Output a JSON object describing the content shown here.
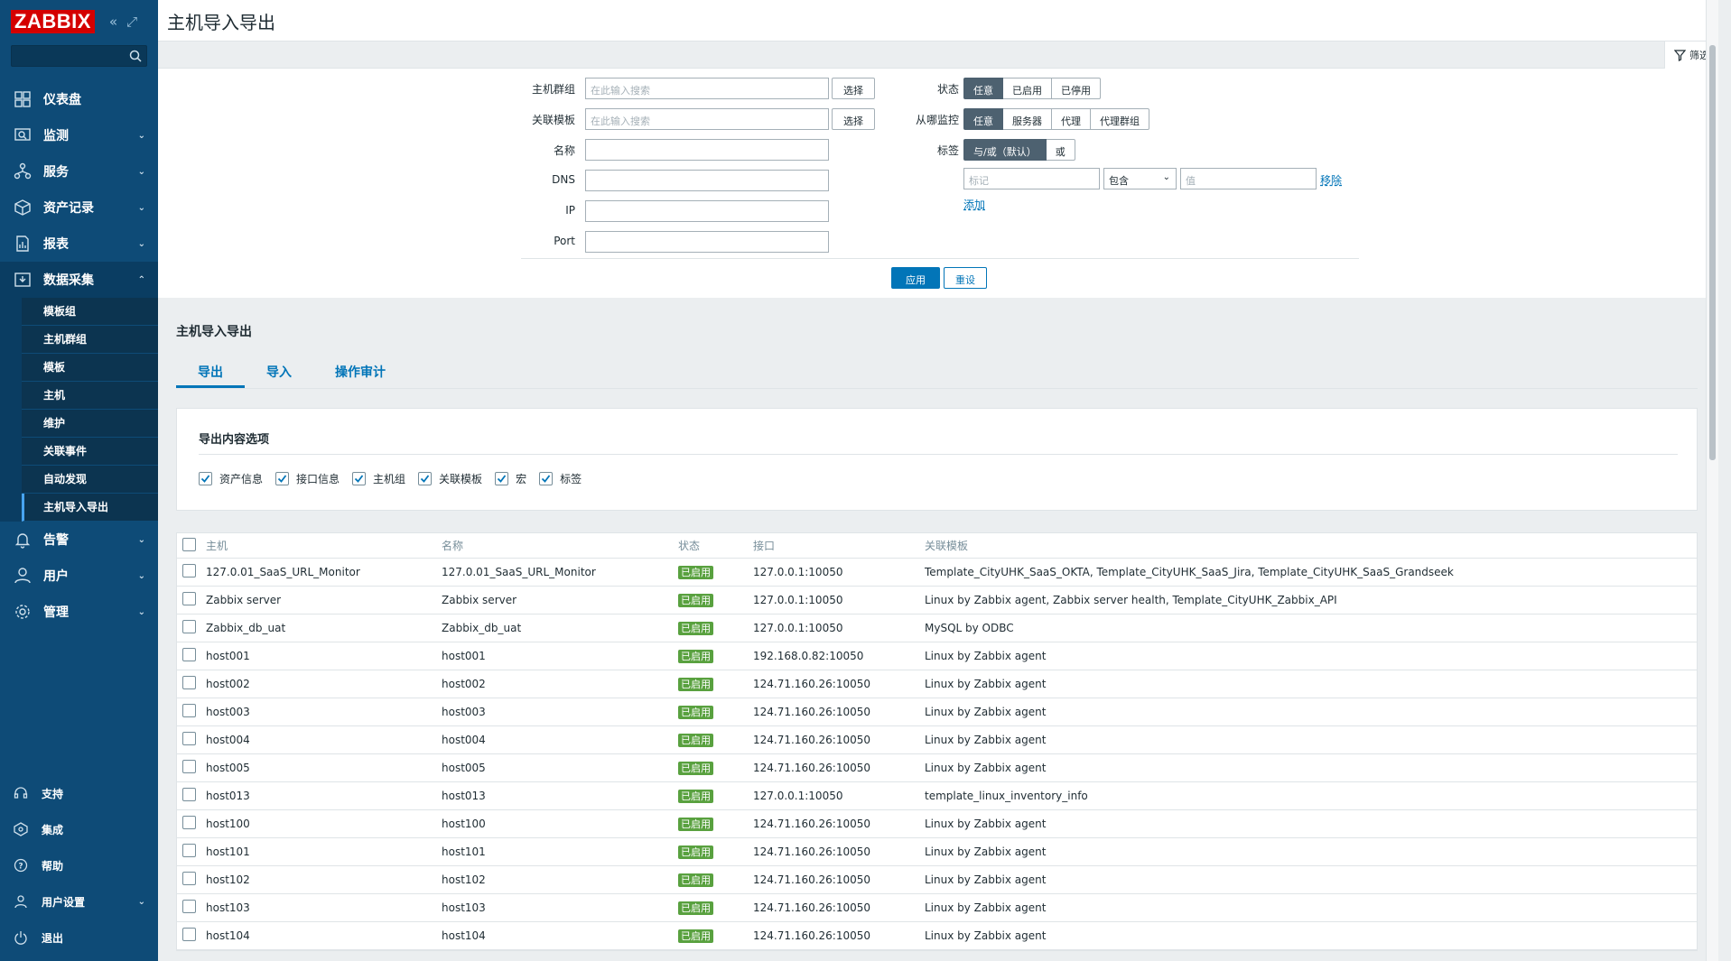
{
  "brand": "ZABBIX",
  "sidebar": {
    "items": [
      {
        "label": "仪表盘",
        "icon": "dashboard-icon"
      },
      {
        "label": "监测",
        "icon": "monitoring-icon"
      },
      {
        "label": "服务",
        "icon": "services-icon"
      },
      {
        "label": "资产记录",
        "icon": "inventory-icon"
      },
      {
        "label": "报表",
        "icon": "reports-icon"
      },
      {
        "label": "数据采集",
        "icon": "data-collection-icon"
      }
    ],
    "sub_items": [
      "模板组",
      "主机群组",
      "模板",
      "主机",
      "维护",
      "关联事件",
      "自动发现",
      "主机导入导出"
    ],
    "items_after": [
      {
        "label": "告警",
        "icon": "bell-icon"
      },
      {
        "label": "用户",
        "icon": "user-icon"
      },
      {
        "label": "管理",
        "icon": "gear-icon"
      }
    ],
    "bottom": [
      {
        "label": "支持",
        "icon": "headset-icon"
      },
      {
        "label": "集成",
        "icon": "integrations-icon"
      },
      {
        "label": "帮助",
        "icon": "help-icon"
      },
      {
        "label": "用户设置",
        "icon": "user-settings-icon"
      },
      {
        "label": "退出",
        "icon": "power-icon"
      }
    ]
  },
  "page": {
    "title": "主机导入导出"
  },
  "filter": {
    "tab_label": "筛选",
    "host_group_label": "主机群组",
    "host_group_placeholder": "在此输入搜索",
    "template_label": "关联模板",
    "template_placeholder": "在此输入搜索",
    "select_label": "选择",
    "name_label": "名称",
    "dns_label": "DNS",
    "ip_label": "IP",
    "port_label": "Port",
    "status_label": "状态",
    "status_options": [
      "任意",
      "已启用",
      "已停用"
    ],
    "monitored_by_label": "从哪监控",
    "monitored_by_options": [
      "任意",
      "服务器",
      "代理",
      "代理群组"
    ],
    "tags_label": "标签",
    "tags_options": [
      "与/或（默认）",
      "或"
    ],
    "tag_placeholder": "标记",
    "tag_operator": "包含",
    "tag_value_placeholder": "值",
    "remove_label": "移除",
    "add_label": "添加",
    "apply_label": "应用",
    "reset_label": "重设"
  },
  "section": {
    "title": "主机导入导出",
    "tabs": [
      "导出",
      "导入",
      "操作审计"
    ]
  },
  "export_options": {
    "title": "导出内容选项",
    "options": [
      "资产信息",
      "接口信息",
      "主机组",
      "关联模板",
      "宏",
      "标签"
    ]
  },
  "table": {
    "headers": [
      "主机",
      "名称",
      "状态",
      "接口",
      "关联模板"
    ],
    "rows": [
      {
        "host": "127.0.01_SaaS_URL_Monitor",
        "name": "127.0.01_SaaS_URL_Monitor",
        "status": "已启用",
        "iface": "127.0.0.1:10050",
        "templates": "Template_CityUHK_SaaS_OKTA, Template_CityUHK_SaaS_Jira, Template_CityUHK_SaaS_Grandseek"
      },
      {
        "host": "Zabbix server",
        "name": "Zabbix server",
        "status": "已启用",
        "iface": "127.0.0.1:10050",
        "templates": "Linux by Zabbix agent, Zabbix server health, Template_CityUHK_Zabbix_API"
      },
      {
        "host": "Zabbix_db_uat",
        "name": "Zabbix_db_uat",
        "status": "已启用",
        "iface": "127.0.0.1:10050",
        "templates": "MySQL by ODBC"
      },
      {
        "host": "host001",
        "name": "host001",
        "status": "已启用",
        "iface": "192.168.0.82:10050",
        "templates": "Linux by Zabbix agent"
      },
      {
        "host": "host002",
        "name": "host002",
        "status": "已启用",
        "iface": "124.71.160.26:10050",
        "templates": "Linux by Zabbix agent"
      },
      {
        "host": "host003",
        "name": "host003",
        "status": "已启用",
        "iface": "124.71.160.26:10050",
        "templates": "Linux by Zabbix agent"
      },
      {
        "host": "host004",
        "name": "host004",
        "status": "已启用",
        "iface": "124.71.160.26:10050",
        "templates": "Linux by Zabbix agent"
      },
      {
        "host": "host005",
        "name": "host005",
        "status": "已启用",
        "iface": "124.71.160.26:10050",
        "templates": "Linux by Zabbix agent"
      },
      {
        "host": "host013",
        "name": "host013",
        "status": "已启用",
        "iface": "127.0.0.1:10050",
        "templates": "template_linux_inventory_info"
      },
      {
        "host": "host100",
        "name": "host100",
        "status": "已启用",
        "iface": "124.71.160.26:10050",
        "templates": "Linux by Zabbix agent"
      },
      {
        "host": "host101",
        "name": "host101",
        "status": "已启用",
        "iface": "124.71.160.26:10050",
        "templates": "Linux by Zabbix agent"
      },
      {
        "host": "host102",
        "name": "host102",
        "status": "已启用",
        "iface": "124.71.160.26:10050",
        "templates": "Linux by Zabbix agent"
      },
      {
        "host": "host103",
        "name": "host103",
        "status": "已启用",
        "iface": "124.71.160.26:10050",
        "templates": "Linux by Zabbix agent"
      },
      {
        "host": "host104",
        "name": "host104",
        "status": "已启用",
        "iface": "124.71.160.26:10050",
        "templates": "Linux by Zabbix agent"
      }
    ]
  },
  "colors": {
    "sidebar": "#0e4b77",
    "accent": "#0275b8",
    "enabled": "#59a13f",
    "brand_red": "#d40000"
  }
}
